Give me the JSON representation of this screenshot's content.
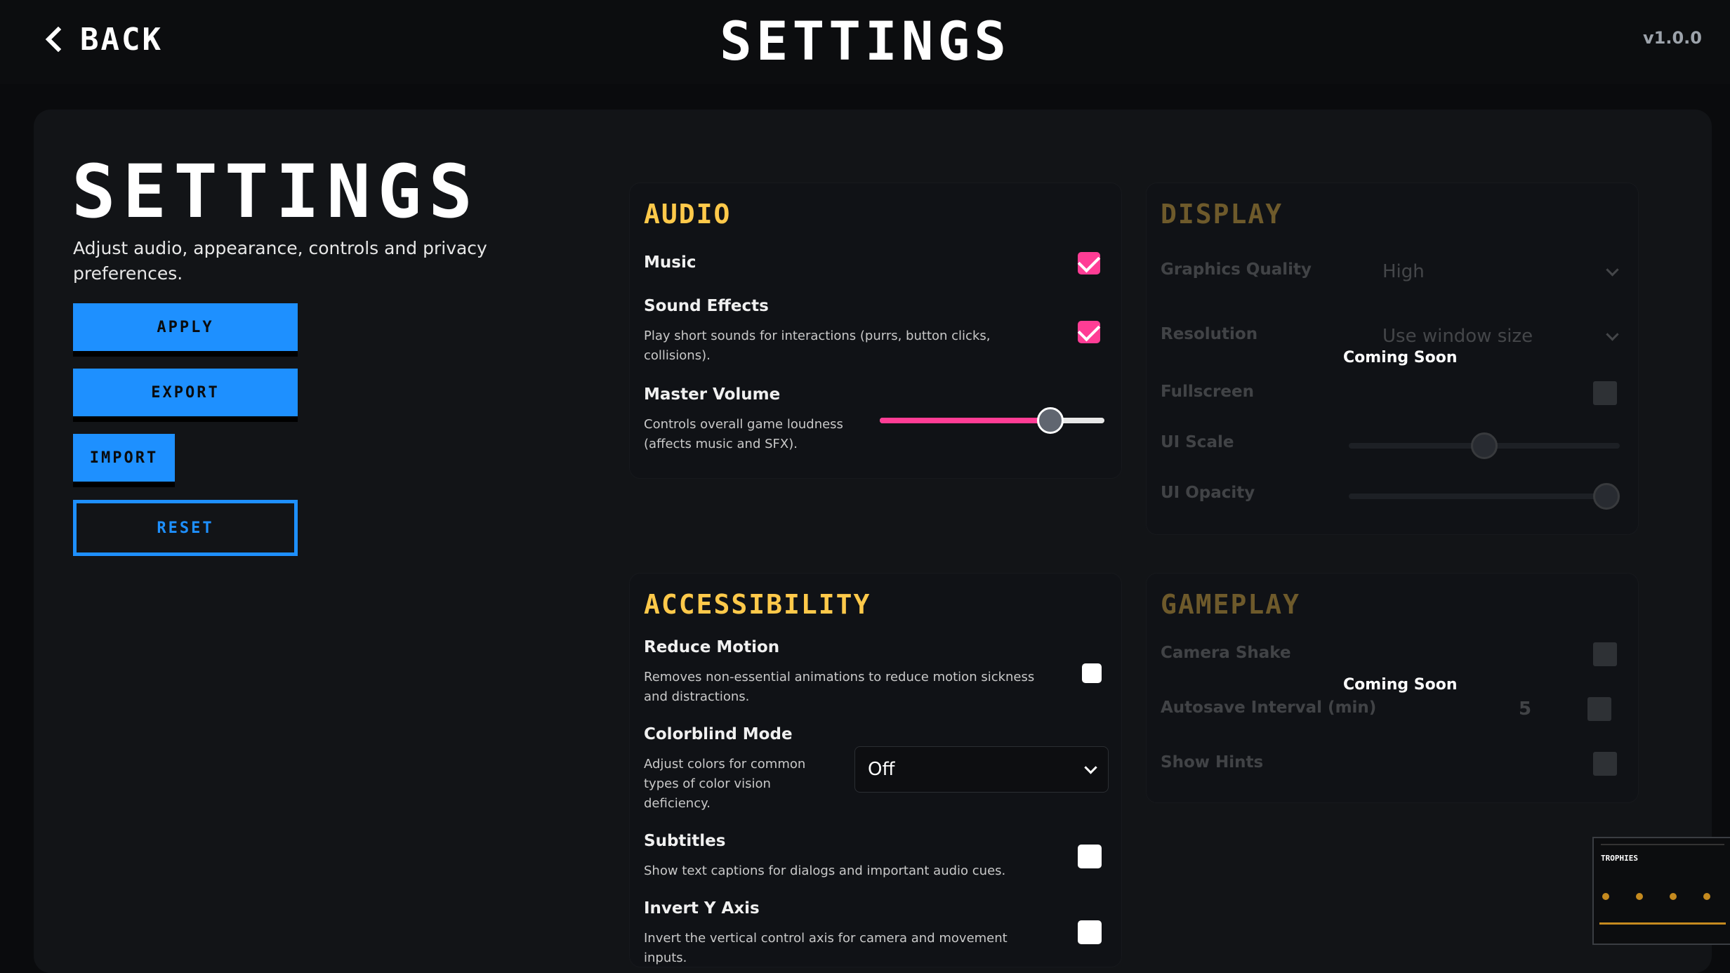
{
  "header": {
    "back_label": "BACK",
    "title": "SETTINGS",
    "version": "v1.0.0"
  },
  "intro": {
    "title": "SETTINGS",
    "subtitle": "Adjust audio, appearance, controls and privacy preferences.",
    "buttons": {
      "apply": "APPLY",
      "export": "EXPORT",
      "import": "IMPORT",
      "reset": "RESET"
    }
  },
  "audio": {
    "title": "AUDIO",
    "music": {
      "label": "Music",
      "checked": true
    },
    "sfx": {
      "label": "Sound Effects",
      "desc": "Play short sounds for interactions (purrs, button clicks, collisions).",
      "checked": true
    },
    "volume": {
      "label": "Master Volume",
      "desc": "Controls overall game loudness (affects music and SFX).",
      "value_fraction": 0.76
    }
  },
  "display": {
    "title": "DISPLAY",
    "coming_soon": "Coming Soon",
    "graphics": {
      "label": "Graphics Quality",
      "value": "High"
    },
    "resolution": {
      "label": "Resolution",
      "value": "Use window size"
    },
    "fullscreen": {
      "label": "Fullscreen"
    },
    "ui_scale": {
      "label": "UI Scale",
      "value_fraction": 0.5
    },
    "ui_opacity": {
      "label": "UI Opacity",
      "value_fraction": 0.95
    }
  },
  "accessibility": {
    "title": "ACCESSIBILITY",
    "reduce_motion": {
      "label": "Reduce Motion",
      "desc": "Removes non-essential animations to reduce motion sickness and distractions.",
      "checked": false
    },
    "colorblind": {
      "label": "Colorblind Mode",
      "desc": "Adjust colors for common types of color vision deficiency.",
      "value": "Off"
    },
    "subtitles": {
      "label": "Subtitles",
      "desc": "Show text captions for dialogs and important audio cues.",
      "checked": false
    },
    "invert_y": {
      "label": "Invert Y Axis",
      "desc": "Invert the vertical control axis for camera and movement inputs.",
      "checked": false
    }
  },
  "gameplay": {
    "title": "GAMEPLAY",
    "coming_soon": "Coming Soon",
    "camera_shake": {
      "label": "Camera Shake"
    },
    "autosave": {
      "label": "Autosave Interval (min)",
      "value": "5"
    },
    "show_hints": {
      "label": "Show Hints"
    }
  },
  "thumbnail": {
    "title": "TROPHIES"
  },
  "colors": {
    "accent_blue": "#1e90ff",
    "accent_pink": "#ff3d95",
    "section_yellow": "#ffc94a"
  }
}
